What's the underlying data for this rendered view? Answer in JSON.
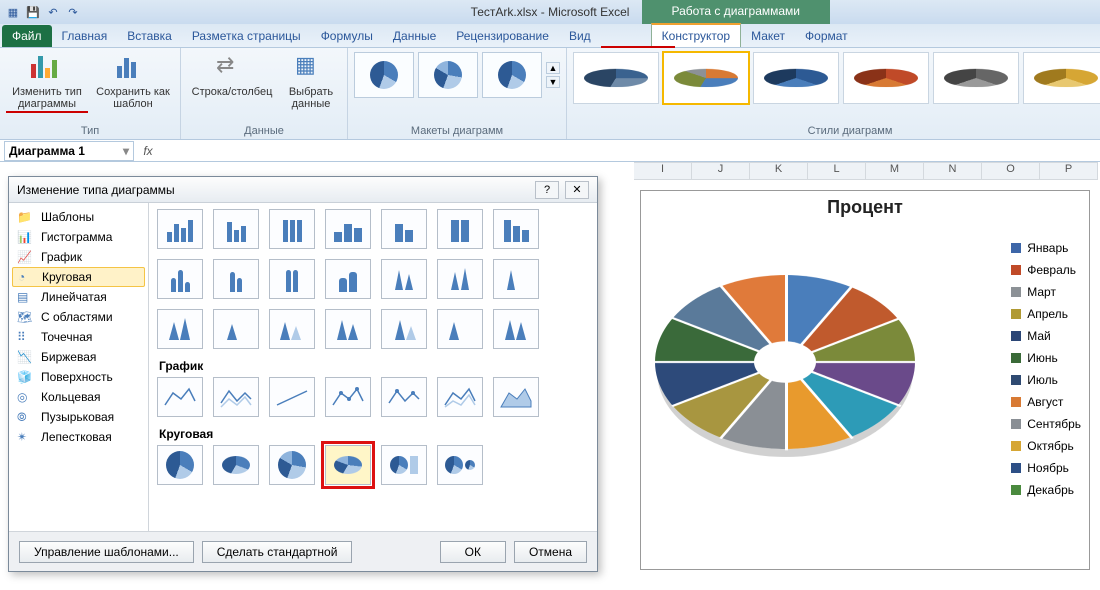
{
  "title": {
    "doc": "ТестArk.xlsx - Microsoft Excel",
    "context": "Работа с диаграммами"
  },
  "tabs": {
    "file": "Файл",
    "items": [
      "Главная",
      "Вставка",
      "Разметка страницы",
      "Формулы",
      "Данные",
      "Рецензирование",
      "Вид"
    ],
    "ctx": [
      "Конструктор",
      "Макет",
      "Формат"
    ]
  },
  "ribbon": {
    "type_group": {
      "change_type": "Изменить тип диаграммы",
      "save_template": "Сохранить как шаблон",
      "label": "Тип"
    },
    "data_group": {
      "switch_rc": "Строка/столбец",
      "select_data": "Выбрать данные",
      "label": "Данные"
    },
    "layouts_group": {
      "label": "Макеты диаграмм"
    },
    "styles_group": {
      "label": "Стили диаграмм"
    }
  },
  "namebox": "Диаграмма 1",
  "columns": [
    "I",
    "J",
    "K",
    "L",
    "M",
    "N",
    "O",
    "P"
  ],
  "dialog": {
    "title": "Изменение типа диаграммы",
    "categories": [
      "Шаблоны",
      "Гистограмма",
      "График",
      "Круговая",
      "Линейчатая",
      "С областями",
      "Точечная",
      "Биржевая",
      "Поверхность",
      "Кольцевая",
      "Пузырьковая",
      "Лепестковая"
    ],
    "selected_cat": 3,
    "sections": {
      "line": "График",
      "pie": "Круговая"
    },
    "buttons": {
      "templates": "Управление шаблонами...",
      "make_default": "Сделать стандартной",
      "ok": "ОК",
      "cancel": "Отмена"
    }
  },
  "chart": {
    "title": "Процент",
    "legend": [
      {
        "label": "Январь",
        "color": "#3d66a8"
      },
      {
        "label": "Февраль",
        "color": "#c04a28"
      },
      {
        "label": "Март",
        "color": "#8c9196"
      },
      {
        "label": "Апрель",
        "color": "#b09a33"
      },
      {
        "label": "Май",
        "color": "#2b4676"
      },
      {
        "label": "Июнь",
        "color": "#3a6a38"
      },
      {
        "label": "Июль",
        "color": "#2f4a72"
      },
      {
        "label": "Август",
        "color": "#d87a34"
      },
      {
        "label": "Сентябрь",
        "color": "#8a8f95"
      },
      {
        "label": "Октябрь",
        "color": "#d6a634"
      },
      {
        "label": "Ноябрь",
        "color": "#2d4f86"
      },
      {
        "label": "Декабрь",
        "color": "#4a8a3e"
      }
    ]
  },
  "chart_data": {
    "type": "pie",
    "title": "Процент",
    "categories": [
      "Январь",
      "Февраль",
      "Март",
      "Апрель",
      "Май",
      "Июнь",
      "Июль",
      "Август",
      "Сентябрь",
      "Октябрь",
      "Ноябрь",
      "Декабрь"
    ],
    "values": [
      8.33,
      8.33,
      8.33,
      8.33,
      8.33,
      8.33,
      8.33,
      8.33,
      8.33,
      8.33,
      8.33,
      8.33
    ]
  }
}
